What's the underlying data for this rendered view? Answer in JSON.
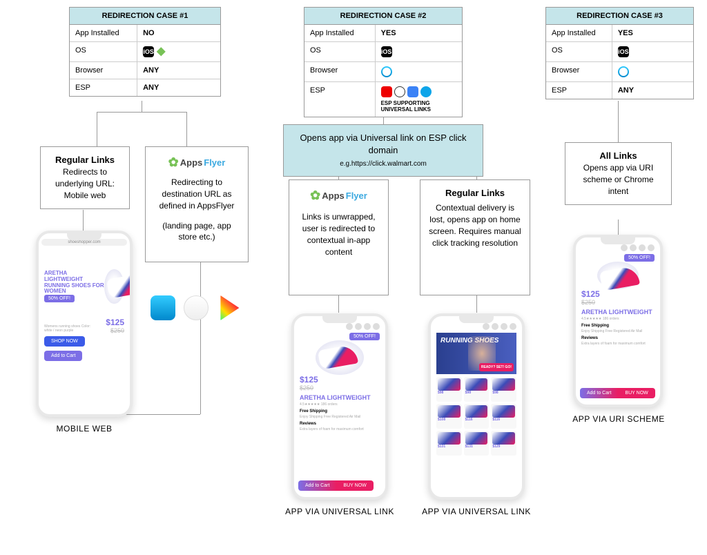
{
  "cases": [
    {
      "title": "REDIRECTION CASE #1",
      "appInstalled": "NO",
      "os_icons": [
        "ios",
        "android"
      ],
      "browser": "ANY",
      "esp": "ANY"
    },
    {
      "title": "REDIRECTION CASE #2",
      "appInstalled": "YES",
      "os_icons": [
        "ios"
      ],
      "browser_icons": [
        "safari"
      ],
      "esp_icons": [
        "oracle",
        "dot",
        "blue",
        "cloud"
      ],
      "esp_note": "ESP SUPPORTING UNIVERSAL LINKS"
    },
    {
      "title": "REDIRECTION CASE #3",
      "appInstalled": "YES",
      "os_icons": [
        "ios"
      ],
      "browser_icons": [
        "safari"
      ],
      "esp": "ANY"
    }
  ],
  "labels": {
    "appInstalled": "App Installed",
    "os": "OS",
    "browser": "Browser",
    "esp": "ESP"
  },
  "box1a_title": "Regular Links",
  "box1a_text": "Redirects to underlying URL: Mobile web",
  "box1b_text1": "Redirecting to destination URL as defined in AppsFlyer",
  "box1b_text2": "(landing page, app store etc.)",
  "box2_top_line1": "Opens app via Universal link on ESP click domain",
  "box2_top_line2": "e.g.https://click.walmart.com",
  "box2a_text": "Links is unwrapped, user is redirected to contextual in-app content",
  "box2b_title": "Regular Links",
  "box2b_text": "Contextual delivery is lost, opens app on home screen. Requires manual click tracking resolution",
  "box3_title": "All Links",
  "box3_text": "Opens app via URI scheme or Chrome intent",
  "results": {
    "r1": "MOBILE WEB",
    "r2a": "APP VIA UNIVERSAL LINK",
    "r2b": "APP VIA UNIVERSAL LINK",
    "r3": "APP VIA URI SCHEME"
  },
  "appsflyer": {
    "apps": "Apps",
    "flyer": "Flyer"
  },
  "phone": {
    "url": "shoeshopper.com",
    "heroTitle": "ARETHA LIGHTWEIGHT RUNNING SHOES FOR WOMEN",
    "offBadge": "50% OFF!",
    "desc": "Womens running shoes Color: white / neon purple",
    "price": "$125",
    "oldPrice": "$250",
    "shopNow": "SHOP NOW",
    "addToCart": "Add to Cart",
    "buyNow": "BUY NOW",
    "prodName": "ARETHA  LIGHTWEIGHT",
    "rating": "4.5★★★★★   186 orders",
    "freeShip": "Free Shipping",
    "reviews": "Reviews",
    "runningShoes": "RUNNING SHOES",
    "ready": "READY? SET! GO!",
    "gridPrices": [
      "$98",
      "$98",
      "$98",
      "$108",
      "$116",
      "$116",
      "$131",
      "$131",
      "$129"
    ]
  }
}
